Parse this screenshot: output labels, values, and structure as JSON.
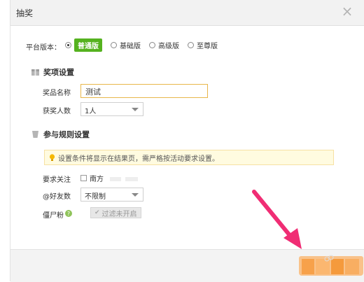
{
  "dialog": {
    "title": "抽奖",
    "close_symbol": "×"
  },
  "platform": {
    "label": "平台版本：",
    "options": [
      {
        "label": "普通版",
        "selected": true
      },
      {
        "label": "基础版",
        "selected": false
      },
      {
        "label": "高级版",
        "selected": false
      },
      {
        "label": "至尊版",
        "selected": false
      }
    ]
  },
  "prize_section": {
    "heading": "奖项设置",
    "prize_name_label": "奖品名称",
    "prize_name_value": "测试",
    "winners_label": "获奖人数",
    "winners_value": "1人"
  },
  "rules_section": {
    "heading": "参与规则设置",
    "notice": "设置条件将显示在结果页，需严格按活动要求设置。",
    "follow_label": "要求关注",
    "follow_option": "南方",
    "friends_label": "@好友数",
    "friends_value": "不限制",
    "zombie_label": "僵尸粉",
    "zombie_option": "过滤未开启"
  },
  "colors": {
    "accent_green": "#55b21f",
    "arrow_pink": "#f02d74",
    "footer_orange": "#f7a14a"
  },
  "icons": [
    "close-icon",
    "gift-icon",
    "rules-icon",
    "lightbulb-icon",
    "help-icon",
    "dropdown-arrow-icon"
  ]
}
